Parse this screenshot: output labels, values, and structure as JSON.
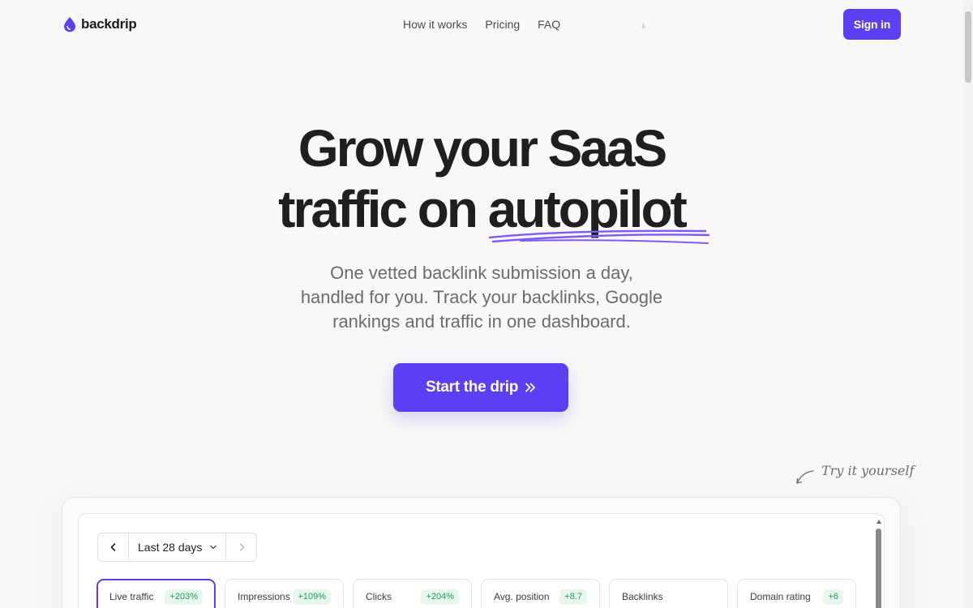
{
  "nav": {
    "brand": "backdrip",
    "links": [
      "How it works",
      "Pricing",
      "FAQ"
    ],
    "signin_label": "Sign in"
  },
  "hero": {
    "title_line1": "Grow your SaaS",
    "title_line2_prefix": "traffic on",
    "title_highlight": "autopilot",
    "subtitle_lines": [
      "One vetted backlink submission a day,",
      "handled for you. Track your backlinks, Google",
      "rankings and traffic in one dashboard."
    ],
    "cta_label": "Start the drip"
  },
  "try_label": "Try it yourself",
  "dashboard": {
    "period": "Last 28 days",
    "metrics": [
      {
        "name": "Live traffic",
        "badge": "+203%"
      },
      {
        "name": "Impressions",
        "badge": "+109%"
      },
      {
        "name": "Clicks",
        "badge": "+204%"
      },
      {
        "name": "Avg. position",
        "badge": "+8.7"
      },
      {
        "name": "Backlinks",
        "badge": ""
      },
      {
        "name": "Domain rating",
        "badge": "+6"
      }
    ]
  },
  "colors": {
    "brand": "#5b3ff5",
    "background": "#f9f8f6",
    "badge_text": "#1f9d55",
    "badge_bg": "#e7f7ee"
  },
  "icons": {
    "logo": "drop-icon",
    "cta": "double-chevron-right-icon",
    "period_prev": "chevron-left-icon",
    "period_select": "chevron-down-icon",
    "period_next": "chevron-right-icon",
    "try": "curved-arrow-icon"
  }
}
